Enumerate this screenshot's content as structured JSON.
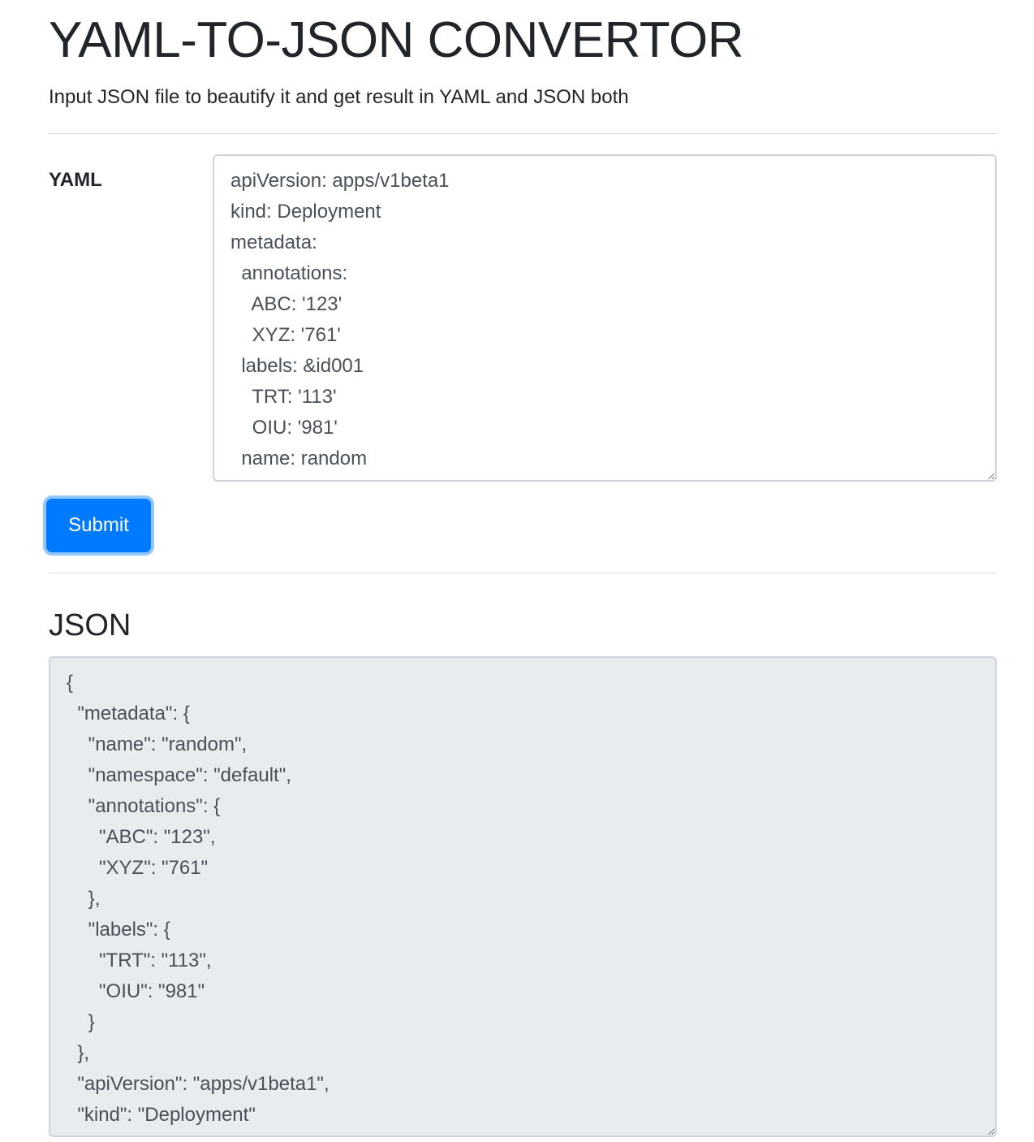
{
  "header": {
    "title": "YAML-TO-JSON CONVERTOR",
    "subtitle": "Input JSON file to beautify it and get result in YAML and JSON both"
  },
  "form": {
    "yaml_label": "YAML",
    "yaml_value": "apiVersion: apps/v1beta1\nkind: Deployment\nmetadata:\n  annotations:\n    ABC: '123'\n    XYZ: '761'\n  labels: &id001\n    TRT: '113'\n    OIU: '981'\n  name: random\n  namespace: default",
    "submit_label": "Submit"
  },
  "result": {
    "title": "JSON",
    "json_value": "{\n  \"metadata\": {\n    \"name\": \"random\",\n    \"namespace\": \"default\",\n    \"annotations\": {\n      \"ABC\": \"123\",\n      \"XYZ\": \"761\"\n    },\n    \"labels\": {\n      \"TRT\": \"113\",\n      \"OIU\": \"981\"\n    }\n  },\n  \"apiVersion\": \"apps/v1beta1\",\n  \"kind\": \"Deployment\"\n}"
  },
  "colors": {
    "primary": "#007bff",
    "text": "#212529",
    "input_text": "#495057",
    "readonly_bg": "#e9ecef",
    "border": "#ced4da"
  }
}
